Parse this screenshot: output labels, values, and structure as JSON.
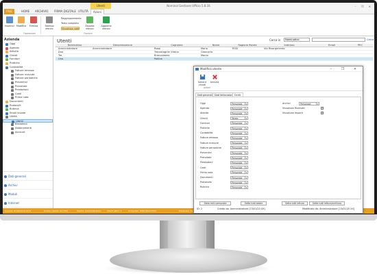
{
  "window": {
    "title": "Nominal Gestione Ufficio 5.8.16",
    "context_tab": "Utenti",
    "controls": "–  ❐  ✕"
  },
  "ribbon": {
    "tabs": [
      "FILE",
      "HOME",
      "ARCHIVIO",
      "FIRMA DIGITALE",
      "UTILITÀ",
      "Azioni"
    ],
    "buttons": {
      "inserisci": "Inserisci",
      "modifica": "Modifica",
      "elimina": "Elimina",
      "stampa": "Stampa elenco",
      "esporta": "Esporta elenco",
      "aggiorna": "Aggiorna elenco"
    },
    "small": {
      "raggruppamento": "Raggruppamento",
      "testo_completo": "Testo completo",
      "visualizza_note": "Visualizza note"
    },
    "groups": {
      "operazioni": "Operazioni",
      "opzioni": "Opzioni"
    }
  },
  "sidebar": {
    "header": "Azienda",
    "items": [
      {
        "label": "Oggi",
        "color": "#3a78c2",
        "indent": 1
      },
      {
        "label": "Agenda",
        "color": "#d9534f",
        "indent": 1
      },
      {
        "label": "Attività",
        "color": "#f0ad4e",
        "indent": 1
      },
      {
        "label": "Clienti",
        "color": "#3a78c2",
        "indent": 1
      },
      {
        "label": "Fornitori",
        "color": "#5cb85c",
        "indent": 1
      },
      {
        "label": "Pratiche",
        "color": "#f0ad4e",
        "indent": 1
      },
      {
        "label": "Contabilità",
        "color": "#3a78c2",
        "indent": 1
      },
      {
        "label": "Fatture emesse",
        "color": "#777777",
        "indent": 2
      },
      {
        "label": "Fatture ricevute",
        "color": "#777777",
        "indent": 2
      },
      {
        "label": "Fatture periodiche",
        "color": "#777777",
        "indent": 2
      },
      {
        "label": "Preventivi",
        "color": "#777777",
        "indent": 2
      },
      {
        "label": "Prenotate",
        "color": "#777777",
        "indent": 2
      },
      {
        "label": "Prestazioni",
        "color": "#777777",
        "indent": 2
      },
      {
        "label": "Costi",
        "color": "#777777",
        "indent": 2
      },
      {
        "label": "Prima nota",
        "color": "#777777",
        "indent": 2
      },
      {
        "label": "Documenti",
        "color": "#f0ad4e",
        "indent": 1
      },
      {
        "label": "Protocolli",
        "color": "#3a78c2",
        "indent": 1
      },
      {
        "label": "Rubrica",
        "color": "#5cb85c",
        "indent": 1
      },
      {
        "label": "Email inviate",
        "color": "#3a78c2",
        "indent": 1
      },
      {
        "label": "Utilità",
        "color": "#777777",
        "indent": 1
      },
      {
        "label": "Utenti",
        "color": "#3a78c2",
        "indent": 2,
        "selected": true
      },
      {
        "label": "Biblioteca",
        "color": "#777777",
        "indent": 2
      },
      {
        "label": "Abbonamenti",
        "color": "#777777",
        "indent": 2
      },
      {
        "label": "Account",
        "color": "#777777",
        "indent": 2
      }
    ],
    "nav": [
      "Dati generali",
      "Archivi",
      "Moduli",
      "Internet"
    ]
  },
  "main": {
    "title": "Utenti",
    "search_label": "Cerca in",
    "search_field": "Nominativo",
    "search_action": "Cerca",
    "columns": [
      "Nominativo",
      "Denominazione",
      "Cognome",
      "Nome",
      "Ragione fiscale",
      "Indirizzo",
      "Email",
      "PEC"
    ],
    "rows": [
      [
        "Amministratore",
        "Amministratore",
        "Rossi",
        "Mario",
        "RSSI",
        "Via Risorgimento",
        "",
        ""
      ],
      [
        "Due",
        "",
        "Trecastagnie Urbino",
        "Giancarlo",
        "",
        "",
        "",
        ""
      ],
      [
        "Tre",
        "",
        "Brancaleone",
        "Marco",
        "",
        "",
        "",
        ""
      ],
      [
        "Uno",
        "",
        "Pallina",
        "",
        "",
        "",
        "",
        ""
      ]
    ]
  },
  "dialog": {
    "title": "Modifica utente",
    "controls": "–  ❐  ✕",
    "save_label": "Salva e chiudi",
    "cancel_label": "Annulla",
    "group": "Azioni",
    "tabs": [
      "Dati generali",
      "Dati fatturazione",
      "Diritti"
    ],
    "permissions": [
      {
        "label": "Oggi",
        "value": "Personale"
      },
      {
        "label": "Agenda",
        "value": "Personale"
      },
      {
        "label": "Attività",
        "value": "Personale"
      },
      {
        "label": "Clienti",
        "value": "Totale"
      },
      {
        "label": "Fornitori",
        "value": "Personale"
      },
      {
        "label": "Pratiche",
        "value": "Personale"
      },
      {
        "label": "Contabilità",
        "value": "Personale"
      },
      {
        "label": "Fatture emesse",
        "value": "Personale"
      },
      {
        "label": "Fatture ricevute",
        "value": "Personale"
      },
      {
        "label": "Fatture periodiche",
        "value": "Personale"
      },
      {
        "label": "Preventivi",
        "value": "Personale"
      },
      {
        "label": "Prenotate",
        "value": "Personale"
      },
      {
        "label": "Prestazioni",
        "value": "Personale"
      },
      {
        "label": "Costi",
        "value": "Personale"
      },
      {
        "label": "Prima nota",
        "value": "Personale"
      },
      {
        "label": "Documenti",
        "value": "Personale"
      },
      {
        "label": "Protocollo",
        "value": "Personale"
      },
      {
        "label": "Rubrica",
        "value": "Personale"
      }
    ],
    "right": {
      "archivi_label": "Archivi",
      "archivi_value": "Personale",
      "visualizza_riservati": "Visualizza Riservati",
      "visualizza_importi": "Visualizza Importi"
    },
    "footer_buttons": [
      "Setta tutti personale",
      "Setta tutti totale",
      "Setta tutti lettura",
      "Setta tutti lettura/scrittura"
    ],
    "info": {
      "id": "ID: 2",
      "created": "Creato da: Amministratore [13/01/20 XX]",
      "modified": "Modificato da: Amministratore [13/01/20 XX]"
    }
  },
  "statusbar": {
    "licenza": "Licenza: ID Nominal 00-0",
    "codice": "Codice cliente: UL7150",
    "utente": "Utente: Amministratore",
    "utenti_attivi": "Utenti attivi: 1",
    "computer": "Computer: WIN10DA17XXX",
    "database": "Database: Tipo: locale | File: [D:\\Nominal] ...\\GestioneUfficio\\Data\\Nominal_Data.sdb"
  },
  "colors": {
    "accent": "#e8a020",
    "selection": "#cde6f7"
  }
}
